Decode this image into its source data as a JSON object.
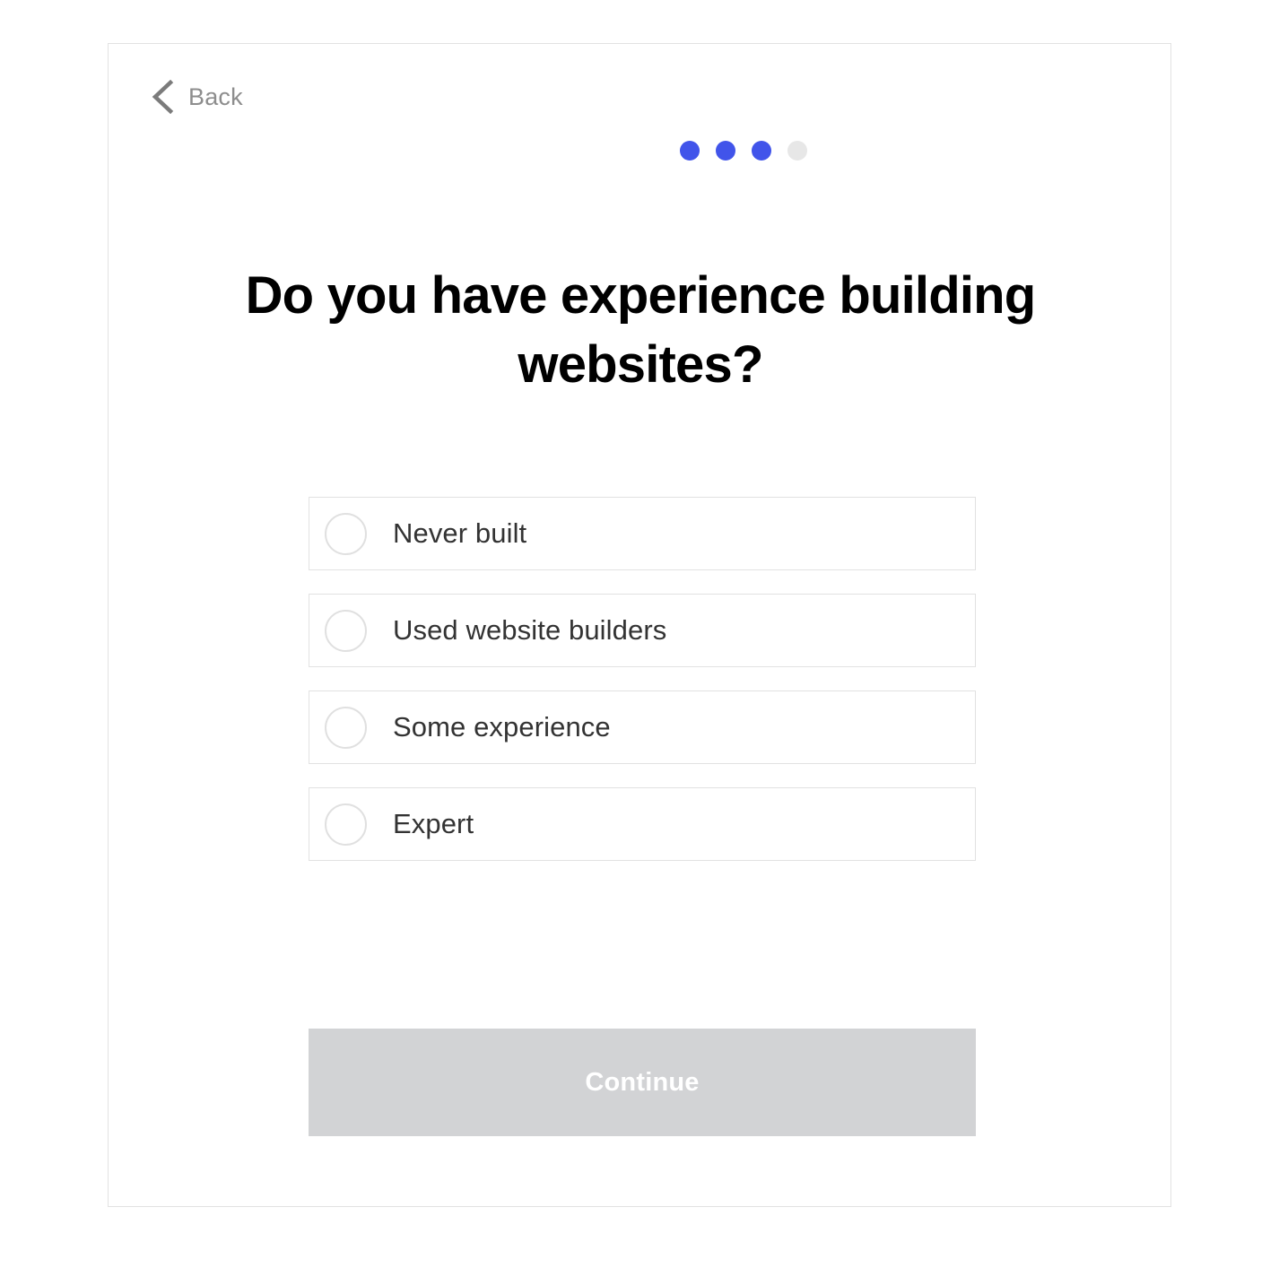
{
  "header": {
    "back_label": "Back",
    "back_icon": "chevron-left-icon",
    "progress": {
      "total_steps": 4,
      "current_step": 3,
      "active_color": "#4154ea",
      "inactive_color": "#e7e7e7",
      "dots": [
        "active",
        "active",
        "active",
        "inactive"
      ]
    }
  },
  "main": {
    "title": "Do you have experience building websites?",
    "options": [
      {
        "label": "Never built",
        "selected": false
      },
      {
        "label": "Used website builders",
        "selected": false
      },
      {
        "label": "Some experience",
        "selected": false
      },
      {
        "label": "Expert",
        "selected": false
      }
    ],
    "continue_label": "Continue",
    "continue_enabled": false
  },
  "colors": {
    "accent": "#4154ea",
    "card_border": "#e2e2e2",
    "option_border": "#e2e2e2",
    "radio_border": "#e0e0e0",
    "title_text": "#000000",
    "option_text": "#333333",
    "back_text": "#8d8d8d",
    "button_disabled_bg": "#d2d3d5",
    "button_text": "#ffffff",
    "page_background": "#ffffff"
  }
}
